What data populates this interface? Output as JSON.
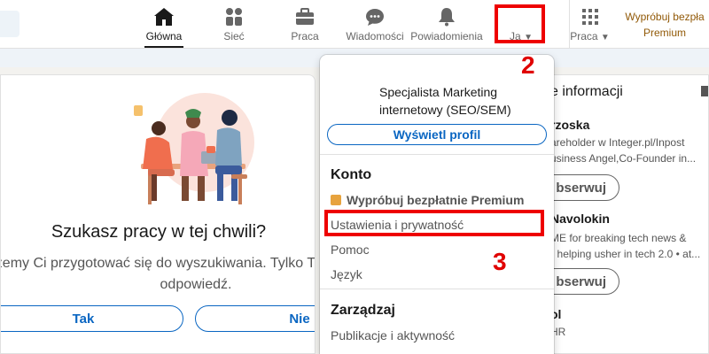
{
  "nav": {
    "items": [
      {
        "label": "Główna",
        "icon": "home-icon"
      },
      {
        "label": "Sieć",
        "icon": "network-icon"
      },
      {
        "label": "Praca",
        "icon": "briefcase-icon"
      },
      {
        "label": "Wiadomości",
        "icon": "messaging-icon"
      },
      {
        "label": "Powiadomienia",
        "icon": "bell-icon"
      }
    ],
    "me_label": "Ja",
    "work_label": "Praca",
    "premium_line1": "Wypróbuj bezpła",
    "premium_line2": "Premium"
  },
  "job_card": {
    "title": "Szukasz pracy w tej chwili?",
    "subtitle_line1": "ożemy Ci przygotować się do wyszukiwania. Tylko T",
    "subtitle_line2": "odpowiedź.",
    "yes_label": "Tak",
    "no_label": "Nie"
  },
  "news_card": {
    "title": "e informacji",
    "people": [
      {
        "name": "rzoska",
        "desc1": "areholder w Integer.pl/Inpost",
        "desc2": "usiness Angel,Co-Founder in...",
        "follow": "bserwuj"
      },
      {
        "name": "Navolokin",
        "desc1": "ME for breaking tech news &",
        "desc2": "• helping usher in tech 2.0 • at...",
        "follow": "bserwuj"
      },
      {
        "name": "ol",
        "desc1": "HR",
        "desc2": "",
        "follow": ""
      }
    ]
  },
  "dropdown": {
    "headline": "Specjalista Marketing internetowy (SEO/SEM)",
    "view_profile": "Wyświetl profil",
    "account_heading": "Konto",
    "premium_item": "Wypróbuj bezpłatnie Premium",
    "settings_item": "Ustawienia i prywatność",
    "help_item": "Pomoc",
    "language_item": "Język",
    "manage_heading": "Zarządzaj",
    "posts_item": "Publikacje i aktywność"
  },
  "annotations": {
    "step2": "2",
    "step3": "3",
    "color": "#ee0000"
  },
  "colors": {
    "brand": "#0a66c2",
    "premium": "#915907"
  }
}
